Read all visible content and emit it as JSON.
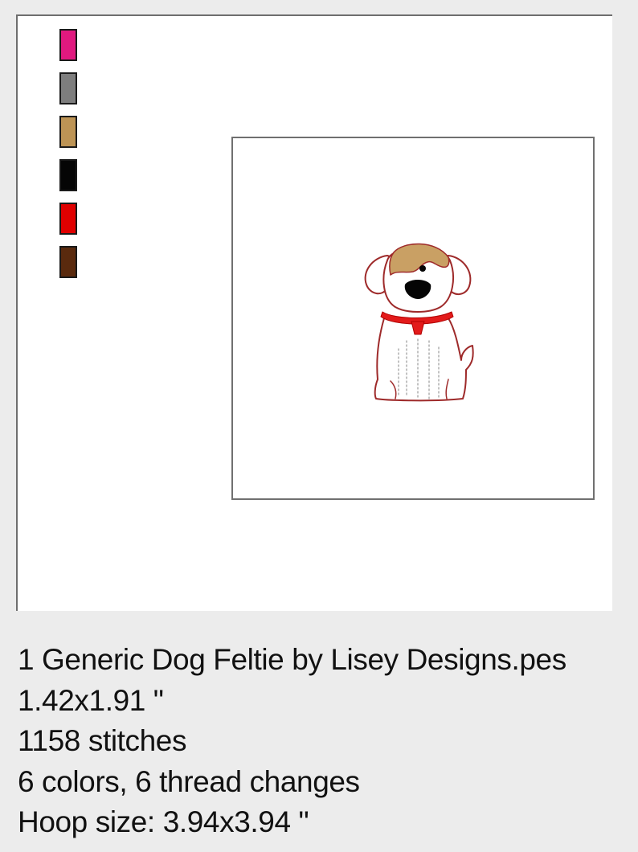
{
  "thread_colors": [
    {
      "name": "pink-thread",
      "color": "#e0197f"
    },
    {
      "name": "gray-thread",
      "color": "#7e7e7e"
    },
    {
      "name": "tan-thread",
      "color": "#bd9455"
    },
    {
      "name": "black-thread",
      "color": "#050505"
    },
    {
      "name": "red-thread",
      "color": "#e00000"
    },
    {
      "name": "brown-thread",
      "color": "#5a2a0e"
    }
  ],
  "design": {
    "icon": "dog-feltie-embroidery",
    "outline_color": "#9e2a2a",
    "patch_color": "#c9a064",
    "collar_color": "#e31b1b",
    "nose_color": "#050505"
  },
  "info": {
    "filename": "1 Generic Dog Feltie by Lisey Designs.pes",
    "dimensions": "1.42x1.91 \"",
    "stitches": "1158 stitches",
    "colors": "6 colors, 6 thread changes",
    "hoop_size": "Hoop size: 3.94x3.94 \""
  }
}
